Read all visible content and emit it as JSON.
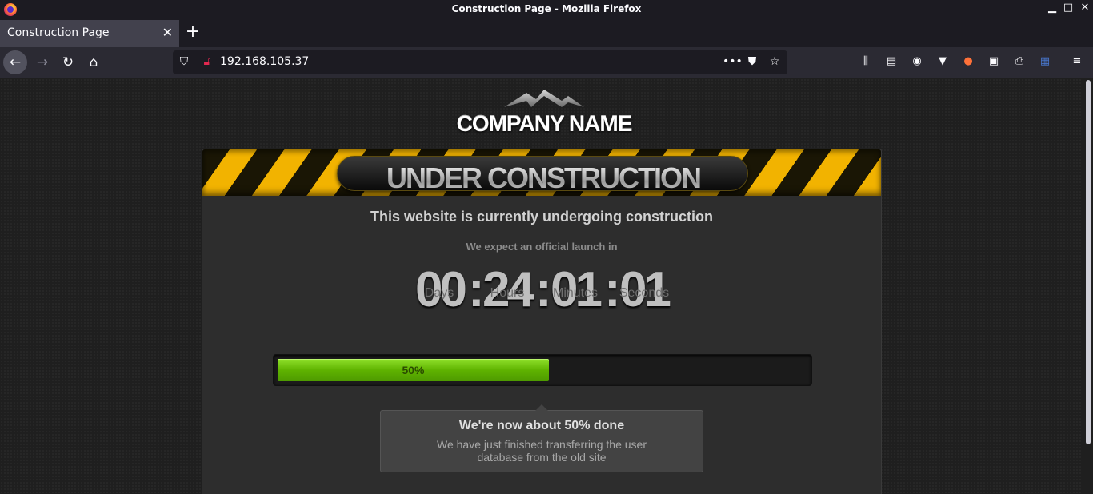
{
  "window": {
    "title": "Construction Page - Mozilla Firefox"
  },
  "tabs": [
    {
      "label": "Construction Page",
      "close": "✕"
    }
  ],
  "new_tab": "+",
  "urlbar": {
    "url": "192.168.105.37"
  },
  "page": {
    "company_name": "COMPANY NAME",
    "banner": "UNDER CONSTRUCTION",
    "headline": "This website is currently undergoing construction",
    "subheadline": "We expect an official launch in",
    "countdown": [
      {
        "value": "00",
        "label": "Days"
      },
      {
        "value": "24",
        "label": "Hours"
      },
      {
        "value": "01",
        "label": "Minutes"
      },
      {
        "value": "01",
        "label": "Seconds"
      }
    ],
    "separator": ":",
    "progress": {
      "percent": 50,
      "label": "50%"
    },
    "tooltip": {
      "title": "We're now about 50% done",
      "body": "We have just finished transferring the user database from the old site"
    }
  },
  "colors": {
    "progress_green": "#5fb300",
    "hazard_yellow": "#f2b300"
  }
}
